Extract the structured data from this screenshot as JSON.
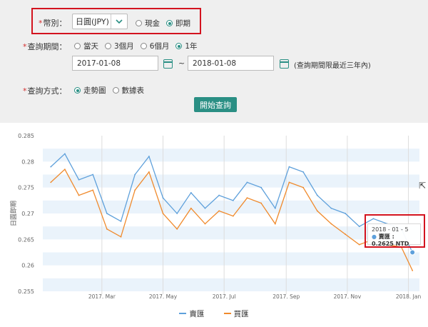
{
  "form": {
    "currency": {
      "label": "幣別：",
      "selected": "日圓(JPY)",
      "options": [
        {
          "label": "現金",
          "selected": false
        },
        {
          "label": "即期",
          "selected": true
        }
      ]
    },
    "period": {
      "label": "查詢期間：",
      "options": [
        {
          "label": "當天",
          "selected": false
        },
        {
          "label": "3個月",
          "selected": false
        },
        {
          "label": "6個月",
          "selected": false
        },
        {
          "label": "1年",
          "selected": true
        }
      ],
      "start_date": "2017-01-08",
      "separator": "~",
      "end_date": "2018-01-08",
      "note": "(查詢期間限最近三年內)"
    },
    "mode": {
      "label": "查詢方式：",
      "options": [
        {
          "label": "走勢圖",
          "selected": true
        },
        {
          "label": "數據表",
          "selected": false
        }
      ]
    },
    "submit_label": "開始查詢"
  },
  "tooltip": {
    "date": "2018 - 01 - 5",
    "text": "賣匯 : 0.2625 NTD"
  },
  "colors": {
    "accent": "#2a8f84",
    "buy": "#f08a2c",
    "sell": "#5ea0db",
    "highlight": "#d3131f"
  },
  "chart_data": {
    "type": "line",
    "ylabel": "日圓即期",
    "ylim": [
      0.255,
      0.285
    ],
    "yticks": [
      "0.285",
      "0.28",
      "0.275",
      "0.27",
      "0.265",
      "0.26",
      "0.255"
    ],
    "xticks": [
      "2017. Mar",
      "2017. May",
      "2017. Jul",
      "2017. Sep",
      "2017. Nov",
      "2018. Jan"
    ],
    "x": [
      "2017-01-09",
      "2017-01-23",
      "2017-02-06",
      "2017-02-20",
      "2017-03-06",
      "2017-03-20",
      "2017-04-03",
      "2017-04-17",
      "2017-05-01",
      "2017-05-15",
      "2017-05-29",
      "2017-06-12",
      "2017-06-26",
      "2017-07-10",
      "2017-07-24",
      "2017-08-07",
      "2017-08-21",
      "2017-09-04",
      "2017-09-18",
      "2017-10-02",
      "2017-10-16",
      "2017-10-30",
      "2017-11-13",
      "2017-11-27",
      "2017-12-11",
      "2017-12-25",
      "2018-01-05"
    ],
    "series": [
      {
        "name": "賣匯",
        "values": [
          0.279,
          0.2815,
          0.2765,
          0.2775,
          0.27,
          0.2685,
          0.2775,
          0.281,
          0.273,
          0.27,
          0.274,
          0.271,
          0.2735,
          0.2725,
          0.276,
          0.275,
          0.271,
          0.279,
          0.278,
          0.2735,
          0.271,
          0.27,
          0.2675,
          0.269,
          0.268,
          0.267,
          0.2625
        ]
      },
      {
        "name": "買匯",
        "values": [
          0.276,
          0.2785,
          0.2735,
          0.2745,
          0.267,
          0.2655,
          0.2745,
          0.278,
          0.27,
          0.267,
          0.271,
          0.268,
          0.2705,
          0.2695,
          0.273,
          0.272,
          0.268,
          0.276,
          0.275,
          0.2705,
          0.268,
          0.266,
          0.264,
          0.265,
          0.264,
          0.2635,
          0.259
        ]
      }
    ]
  }
}
